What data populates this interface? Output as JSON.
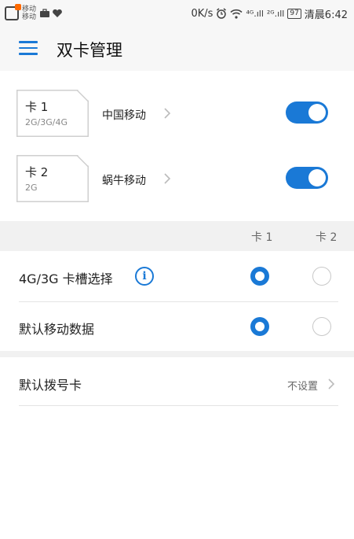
{
  "status_bar": {
    "carrier_top": "移动",
    "carrier_bottom": "移动",
    "network_speed": "0K/s",
    "signal_1": "⁴ᴳ.ıll",
    "signal_2": "²ᴳ.ıll",
    "battery": "97",
    "time": "清晨6:42"
  },
  "app_bar": {
    "title": "双卡管理"
  },
  "sims": [
    {
      "card_label": "卡 1",
      "network_types": "2G/3G/4G",
      "carrier": "中国移动",
      "enabled": true
    },
    {
      "card_label": "卡 2",
      "network_types": "2G",
      "carrier": "蜗牛移动",
      "enabled": true
    }
  ],
  "columns": {
    "card1": "卡 1",
    "card2": "卡 2"
  },
  "settings": {
    "slot_select": {
      "label": "4G/3G 卡槽选择",
      "selected": "card1"
    },
    "default_data": {
      "label": "默认移动数据",
      "selected": "card1"
    },
    "default_dial": {
      "label": "默认拨号卡",
      "value": "不设置"
    }
  },
  "colors": {
    "accent": "#1a79d6",
    "band": "#f1f1f1",
    "divider": "#e4e4e4"
  }
}
